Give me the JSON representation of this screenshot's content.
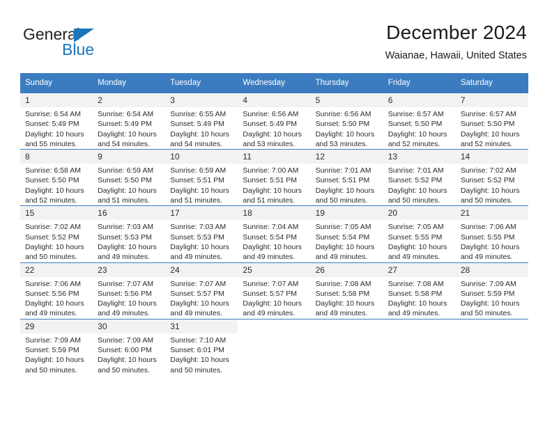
{
  "brand": {
    "name_part1": "General",
    "name_part2": "Blue",
    "logo_icon": "triangle-flag-icon",
    "color_dark": "#231f20",
    "color_blue": "#1b75bb"
  },
  "header": {
    "title": "December 2024",
    "subtitle": "Waianae, Hawaii, United States"
  },
  "calendar": {
    "accent_color": "#3b7cc0",
    "daynum_bg": "#f2f2f2",
    "weekday_headers": [
      "Sunday",
      "Monday",
      "Tuesday",
      "Wednesday",
      "Thursday",
      "Friday",
      "Saturday"
    ],
    "weeks": [
      [
        {
          "day": "1",
          "sunrise": "Sunrise: 6:54 AM",
          "sunset": "Sunset: 5:49 PM",
          "daylight_line1": "Daylight: 10 hours",
          "daylight_line2": "and 55 minutes."
        },
        {
          "day": "2",
          "sunrise": "Sunrise: 6:54 AM",
          "sunset": "Sunset: 5:49 PM",
          "daylight_line1": "Daylight: 10 hours",
          "daylight_line2": "and 54 minutes."
        },
        {
          "day": "3",
          "sunrise": "Sunrise: 6:55 AM",
          "sunset": "Sunset: 5:49 PM",
          "daylight_line1": "Daylight: 10 hours",
          "daylight_line2": "and 54 minutes."
        },
        {
          "day": "4",
          "sunrise": "Sunrise: 6:56 AM",
          "sunset": "Sunset: 5:49 PM",
          "daylight_line1": "Daylight: 10 hours",
          "daylight_line2": "and 53 minutes."
        },
        {
          "day": "5",
          "sunrise": "Sunrise: 6:56 AM",
          "sunset": "Sunset: 5:50 PM",
          "daylight_line1": "Daylight: 10 hours",
          "daylight_line2": "and 53 minutes."
        },
        {
          "day": "6",
          "sunrise": "Sunrise: 6:57 AM",
          "sunset": "Sunset: 5:50 PM",
          "daylight_line1": "Daylight: 10 hours",
          "daylight_line2": "and 52 minutes."
        },
        {
          "day": "7",
          "sunrise": "Sunrise: 6:57 AM",
          "sunset": "Sunset: 5:50 PM",
          "daylight_line1": "Daylight: 10 hours",
          "daylight_line2": "and 52 minutes."
        }
      ],
      [
        {
          "day": "8",
          "sunrise": "Sunrise: 6:58 AM",
          "sunset": "Sunset: 5:50 PM",
          "daylight_line1": "Daylight: 10 hours",
          "daylight_line2": "and 52 minutes."
        },
        {
          "day": "9",
          "sunrise": "Sunrise: 6:59 AM",
          "sunset": "Sunset: 5:50 PM",
          "daylight_line1": "Daylight: 10 hours",
          "daylight_line2": "and 51 minutes."
        },
        {
          "day": "10",
          "sunrise": "Sunrise: 6:59 AM",
          "sunset": "Sunset: 5:51 PM",
          "daylight_line1": "Daylight: 10 hours",
          "daylight_line2": "and 51 minutes."
        },
        {
          "day": "11",
          "sunrise": "Sunrise: 7:00 AM",
          "sunset": "Sunset: 5:51 PM",
          "daylight_line1": "Daylight: 10 hours",
          "daylight_line2": "and 51 minutes."
        },
        {
          "day": "12",
          "sunrise": "Sunrise: 7:01 AM",
          "sunset": "Sunset: 5:51 PM",
          "daylight_line1": "Daylight: 10 hours",
          "daylight_line2": "and 50 minutes."
        },
        {
          "day": "13",
          "sunrise": "Sunrise: 7:01 AM",
          "sunset": "Sunset: 5:52 PM",
          "daylight_line1": "Daylight: 10 hours",
          "daylight_line2": "and 50 minutes."
        },
        {
          "day": "14",
          "sunrise": "Sunrise: 7:02 AM",
          "sunset": "Sunset: 5:52 PM",
          "daylight_line1": "Daylight: 10 hours",
          "daylight_line2": "and 50 minutes."
        }
      ],
      [
        {
          "day": "15",
          "sunrise": "Sunrise: 7:02 AM",
          "sunset": "Sunset: 5:52 PM",
          "daylight_line1": "Daylight: 10 hours",
          "daylight_line2": "and 50 minutes."
        },
        {
          "day": "16",
          "sunrise": "Sunrise: 7:03 AM",
          "sunset": "Sunset: 5:53 PM",
          "daylight_line1": "Daylight: 10 hours",
          "daylight_line2": "and 49 minutes."
        },
        {
          "day": "17",
          "sunrise": "Sunrise: 7:03 AM",
          "sunset": "Sunset: 5:53 PM",
          "daylight_line1": "Daylight: 10 hours",
          "daylight_line2": "and 49 minutes."
        },
        {
          "day": "18",
          "sunrise": "Sunrise: 7:04 AM",
          "sunset": "Sunset: 5:54 PM",
          "daylight_line1": "Daylight: 10 hours",
          "daylight_line2": "and 49 minutes."
        },
        {
          "day": "19",
          "sunrise": "Sunrise: 7:05 AM",
          "sunset": "Sunset: 5:54 PM",
          "daylight_line1": "Daylight: 10 hours",
          "daylight_line2": "and 49 minutes."
        },
        {
          "day": "20",
          "sunrise": "Sunrise: 7:05 AM",
          "sunset": "Sunset: 5:55 PM",
          "daylight_line1": "Daylight: 10 hours",
          "daylight_line2": "and 49 minutes."
        },
        {
          "day": "21",
          "sunrise": "Sunrise: 7:06 AM",
          "sunset": "Sunset: 5:55 PM",
          "daylight_line1": "Daylight: 10 hours",
          "daylight_line2": "and 49 minutes."
        }
      ],
      [
        {
          "day": "22",
          "sunrise": "Sunrise: 7:06 AM",
          "sunset": "Sunset: 5:56 PM",
          "daylight_line1": "Daylight: 10 hours",
          "daylight_line2": "and 49 minutes."
        },
        {
          "day": "23",
          "sunrise": "Sunrise: 7:07 AM",
          "sunset": "Sunset: 5:56 PM",
          "daylight_line1": "Daylight: 10 hours",
          "daylight_line2": "and 49 minutes."
        },
        {
          "day": "24",
          "sunrise": "Sunrise: 7:07 AM",
          "sunset": "Sunset: 5:57 PM",
          "daylight_line1": "Daylight: 10 hours",
          "daylight_line2": "and 49 minutes."
        },
        {
          "day": "25",
          "sunrise": "Sunrise: 7:07 AM",
          "sunset": "Sunset: 5:57 PM",
          "daylight_line1": "Daylight: 10 hours",
          "daylight_line2": "and 49 minutes."
        },
        {
          "day": "26",
          "sunrise": "Sunrise: 7:08 AM",
          "sunset": "Sunset: 5:58 PM",
          "daylight_line1": "Daylight: 10 hours",
          "daylight_line2": "and 49 minutes."
        },
        {
          "day": "27",
          "sunrise": "Sunrise: 7:08 AM",
          "sunset": "Sunset: 5:58 PM",
          "daylight_line1": "Daylight: 10 hours",
          "daylight_line2": "and 49 minutes."
        },
        {
          "day": "28",
          "sunrise": "Sunrise: 7:09 AM",
          "sunset": "Sunset: 5:59 PM",
          "daylight_line1": "Daylight: 10 hours",
          "daylight_line2": "and 50 minutes."
        }
      ],
      [
        {
          "day": "29",
          "sunrise": "Sunrise: 7:09 AM",
          "sunset": "Sunset: 5:59 PM",
          "daylight_line1": "Daylight: 10 hours",
          "daylight_line2": "and 50 minutes."
        },
        {
          "day": "30",
          "sunrise": "Sunrise: 7:09 AM",
          "sunset": "Sunset: 6:00 PM",
          "daylight_line1": "Daylight: 10 hours",
          "daylight_line2": "and 50 minutes."
        },
        {
          "day": "31",
          "sunrise": "Sunrise: 7:10 AM",
          "sunset": "Sunset: 6:01 PM",
          "daylight_line1": "Daylight: 10 hours",
          "daylight_line2": "and 50 minutes."
        },
        {
          "day": "",
          "sunrise": "",
          "sunset": "",
          "daylight_line1": "",
          "daylight_line2": ""
        },
        {
          "day": "",
          "sunrise": "",
          "sunset": "",
          "daylight_line1": "",
          "daylight_line2": ""
        },
        {
          "day": "",
          "sunrise": "",
          "sunset": "",
          "daylight_line1": "",
          "daylight_line2": ""
        },
        {
          "day": "",
          "sunrise": "",
          "sunset": "",
          "daylight_line1": "",
          "daylight_line2": ""
        }
      ]
    ]
  }
}
